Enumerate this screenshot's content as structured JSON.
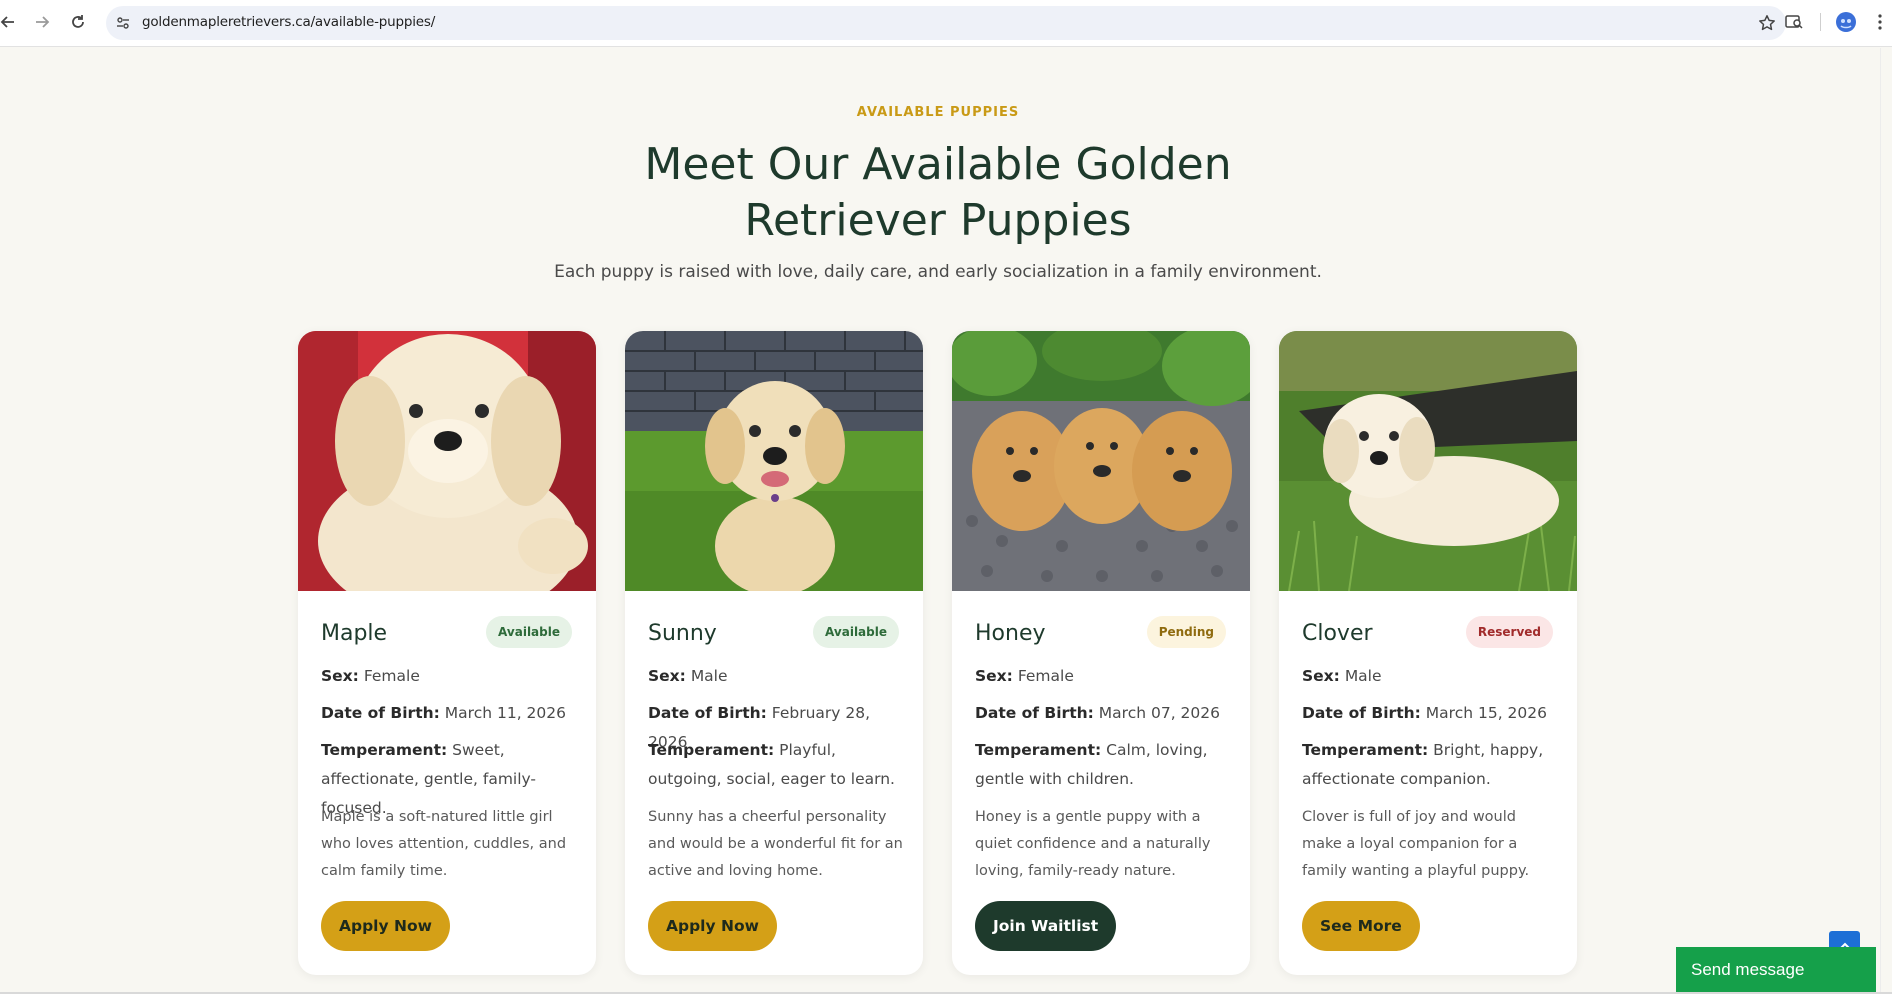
{
  "browser": {
    "url": "goldenmapleretrievers.ca/available-puppies/",
    "icons": [
      "back-icon",
      "forward-icon",
      "reload-icon",
      "site-info-icon",
      "bookmark-star-icon",
      "search-tabs-icon",
      "profile-avatar",
      "more-menu-icon"
    ]
  },
  "section": {
    "eyebrow": "AVAILABLE PUPPIES",
    "title": "Meet Our Available Golden Retriever Puppies",
    "subtitle": "Each puppy is raised with love, daily care, and early socialization in a family environment."
  },
  "labels": {
    "sex": "Sex:",
    "dob": "Date of Birth:",
    "temperament": "Temperament:"
  },
  "puppies": [
    {
      "name": "Maple",
      "status": "Available",
      "sex": "Female",
      "dob": "March 11, 2026",
      "temperament": "Sweet, affectionate, gentle, family-focused.",
      "description": "Maple is a soft-natured little girl who loves attention, cuddles, and calm family time.",
      "cta": "Apply Now"
    },
    {
      "name": "Sunny",
      "status": "Available",
      "sex": "Male",
      "dob": "February 28, 2026",
      "temperament": "Playful, outgoing, social, eager to learn.",
      "description": "Sunny has a cheerful personality and would be a wonderful fit for an active and loving home.",
      "cta": "Apply Now"
    },
    {
      "name": "Honey",
      "status": "Pending",
      "sex": "Female",
      "dob": "March 07, 2026",
      "temperament": "Calm, loving, gentle with children.",
      "description": "Honey is a gentle puppy with a quiet confidence and a naturally loving, family-ready nature.",
      "cta": "Join Waitlist"
    },
    {
      "name": "Clover",
      "status": "Reserved",
      "sex": "Male",
      "dob": "March 15, 2026",
      "temperament": "Bright, happy, affectionate companion.",
      "description": "Clover is full of joy and would make a loyal companion for a family wanting a playful puppy.",
      "cta": "See More"
    }
  ],
  "widgets": {
    "send_message": "Send message"
  },
  "colors": {
    "accent_gold": "#d4a017",
    "dark_green": "#1e3a2c",
    "page_bg": "#f8f7f2",
    "chat_green": "#15a04a",
    "to_top_blue": "#1d6fd6"
  }
}
